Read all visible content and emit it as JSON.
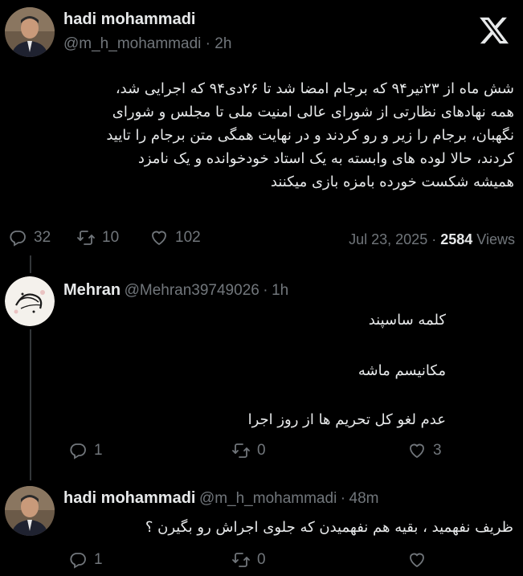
{
  "main_tweet": {
    "author_name": "hadi mohammadi",
    "handle": "@m_h_mohammadi",
    "sep": "·",
    "time": "2h",
    "text_lines": [
      "شش ماه از ۲۳تیر۹۴ که برجام امضا شد تا ۲۶دی۹۴ که اجرایی شد،",
      "همه نهادهای نظارتی از شورای عالی امنیت ملی تا مجلس و شورای",
      "نگهبان، برجام را زیر و رو کردند و در نهایت همگی متن برجام را تایید",
      "کردند، حالا لوده های وابسته به یک استاد خودخوانده و یک نامزد",
      "همیشه شکست خورده بامزه بازی میکنند"
    ],
    "replies": "32",
    "reposts": "10",
    "likes": "102",
    "date": "Jul 23, 2025",
    "date_sep": "·",
    "views_count": "2584",
    "views_label": "Views"
  },
  "reply1": {
    "author_name": "Mehran",
    "handle": "@Mehran39749026",
    "sep": "·",
    "time": "1h",
    "lines": [
      "کلمه ساسپند",
      "مکانیسم ماشه",
      "عدم لغو کل تحریم ها از روز اجرا"
    ],
    "replies": "1",
    "reposts": "0",
    "likes": "3"
  },
  "reply2": {
    "author_name": "hadi mohammadi",
    "handle": "@m_h_mohammadi",
    "sep": "·",
    "time": "48m",
    "text": "ظریف نفهمید ، بقیه هم نفهمیدن که جلوی اجراش رو بگیرن ؟",
    "replies": "1",
    "reposts": "0"
  },
  "icons": {
    "logo": "x-logo-icon",
    "reply": "reply-icon",
    "repost": "repost-icon",
    "like": "heart-icon"
  },
  "colors": {
    "background": "#000000",
    "text": "#e7e9ea",
    "muted": "#71767b"
  }
}
